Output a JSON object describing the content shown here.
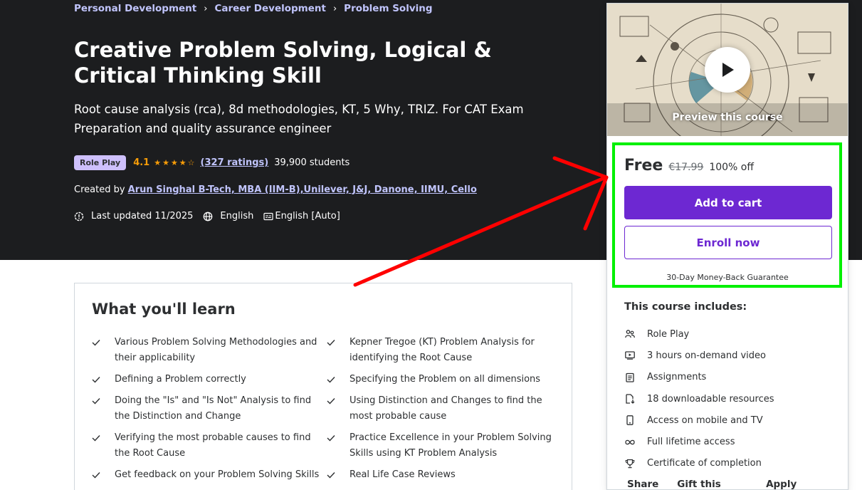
{
  "breadcrumbs": [
    "Personal Development",
    "Career Development",
    "Problem Solving"
  ],
  "course": {
    "title": "Creative Problem Solving, Logical & Critical Thinking Skill",
    "subtitle": "Root cause analysis (rca), 8d methodologies, KT, 5 Why, TRIZ. For CAT Exam Preparation and quality assurance engineer",
    "badge": "Role Play",
    "rating": "4.1",
    "rating_stars": 4.1,
    "ratings_count": "(327 ratings)",
    "students": "39,900 students",
    "created_by_label": "Created by",
    "author": "Arun Singhal B-Tech, MBA (IIM-B),Unilever, J&J, Danone, IIMU, Cello",
    "last_updated": "Last updated 11/2025",
    "language": "English",
    "captions": "English [Auto]"
  },
  "sidebar": {
    "preview_label": "Preview this course",
    "price": "Free",
    "original_price": "€17.99",
    "discount": "100% off",
    "add_to_cart": "Add to cart",
    "enroll_now": "Enroll now",
    "guarantee": "30-Day Money-Back Guarantee",
    "includes_title": "This course includes:",
    "includes": [
      {
        "icon": "role-play-icon",
        "label": "Role Play"
      },
      {
        "icon": "video-icon",
        "label": "3 hours on-demand video"
      },
      {
        "icon": "assignment-icon",
        "label": "Assignments"
      },
      {
        "icon": "download-file-icon",
        "label": "18 downloadable resources"
      },
      {
        "icon": "mobile-icon",
        "label": "Access on mobile and TV"
      },
      {
        "icon": "infinity-icon",
        "label": "Full lifetime access"
      },
      {
        "icon": "trophy-icon",
        "label": "Certificate of completion"
      }
    ],
    "links": [
      "Share",
      "Gift this course",
      "Apply Coupon"
    ]
  },
  "learn": {
    "title": "What you'll learn",
    "items": [
      [
        "Various Problem Solving Methodologies and their applicability",
        "Kepner Tregoe (KT) Problem Analysis for identifying the Root Cause"
      ],
      [
        "Defining a Problem correctly",
        "Specifying the Problem on all dimensions"
      ],
      [
        "Doing the \"Is\" and \"Is Not\" Analysis to find the Distinction and Change",
        "Using Distinction and Changes to find the most probable cause"
      ],
      [
        "Verifying the most probable causes to find the Root Cause",
        "Practice Excellence in your Problem Solving Skills using KT Problem Analysis"
      ],
      [
        "Get feedback on your Problem Solving Skills",
        "Real Life Case Reviews"
      ]
    ]
  },
  "colors": {
    "hero_bg": "#1c1d1f",
    "accent_purple": "#6d28d2",
    "link_lavender": "#c0c4fc",
    "star_orange": "#f69c08",
    "annotation_red": "#ff0000",
    "annotation_green": "#00f000"
  }
}
